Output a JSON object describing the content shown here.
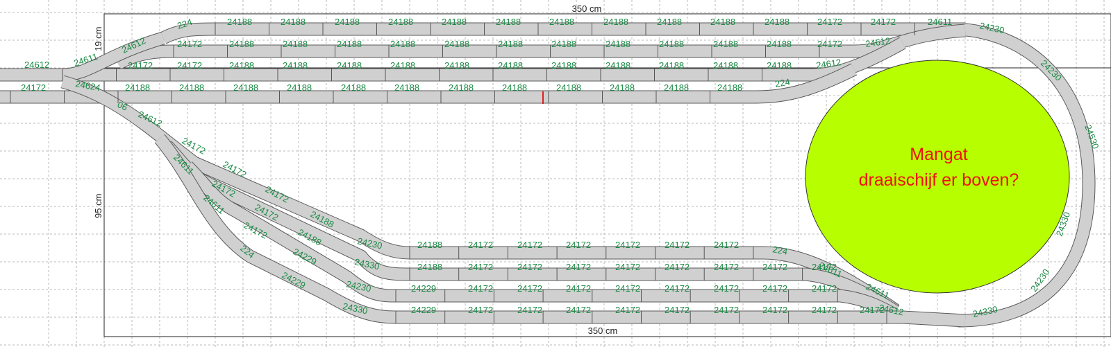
{
  "dimensions": {
    "top": "350 cm",
    "bottom": "350 cm",
    "left_small": "19 cm",
    "left_large": "95 cm"
  },
  "note": {
    "line1": "Mangat",
    "line2": "draaischijf er boven?"
  },
  "colors": {
    "hole": "#b7ff00",
    "label": "#1a8a44",
    "note": "#ee1111",
    "rail": "#d0d0d0"
  },
  "labels": {
    "row1": [
      "224",
      "24188",
      "24188",
      "24188",
      "24188",
      "24188",
      "24188",
      "24188",
      "24188",
      "24188",
      "24188",
      "24188",
      "24172",
      "24172",
      "24611",
      "24230"
    ],
    "row2": [
      "24612",
      "24172",
      "24188",
      "24188",
      "24188",
      "24188",
      "24188",
      "24188",
      "24188",
      "24188",
      "24188",
      "24188",
      "24188",
      "24172",
      "24612",
      "24230"
    ],
    "row3": [
      "24611",
      "24172",
      "24172",
      "24188",
      "24188",
      "24188",
      "24188",
      "24188",
      "24188",
      "24188",
      "24188",
      "24188",
      "24188",
      "24188",
      "24612"
    ],
    "row4": [
      "24612",
      "24172",
      "24624",
      "24188",
      "24188",
      "24188",
      "24188",
      "24188",
      "24188",
      "24188",
      "24188",
      "24188",
      "24188",
      "24188",
      "24188",
      "224",
      "06"
    ],
    "diag": [
      "24612",
      "24172",
      "24172",
      "24172",
      "24188",
      "24230",
      "24611",
      "24172",
      "24172",
      "24188",
      "24330",
      "24611",
      "24172",
      "24229",
      "24230",
      "224",
      "24229",
      "24330"
    ],
    "lower1": [
      "24188",
      "24172",
      "24172",
      "24172",
      "24172",
      "24172",
      "24172",
      "224",
      "24611"
    ],
    "lower2": [
      "24188",
      "24172",
      "24172",
      "24172",
      "24172",
      "24172",
      "24172",
      "24172",
      "24172",
      "24611"
    ],
    "lower3": [
      "24229",
      "24172",
      "24172",
      "24172",
      "24172",
      "24172",
      "24172",
      "24172",
      "24172",
      "24612"
    ],
    "lower4": [
      "24229",
      "24172",
      "24172",
      "24172",
      "24172",
      "24172",
      "24172",
      "24172",
      "24172",
      "24172"
    ],
    "loop": [
      "24530",
      "24330",
      "24230",
      "24330"
    ]
  }
}
